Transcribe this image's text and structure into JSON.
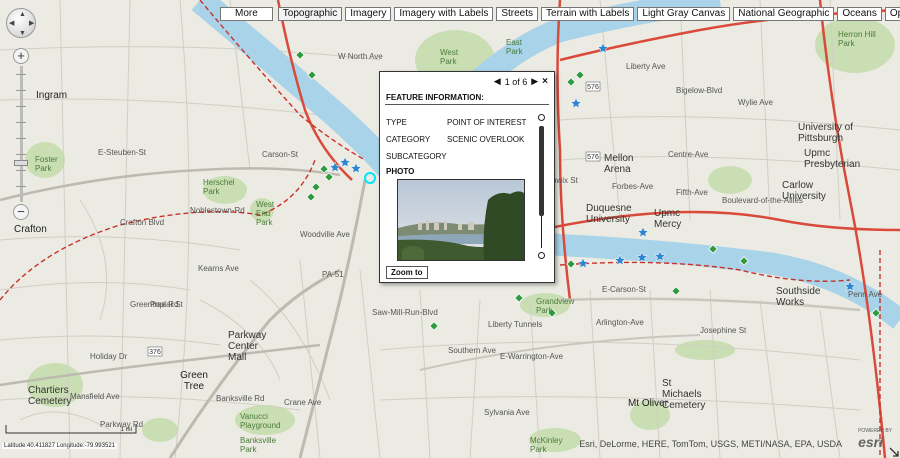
{
  "toolbar": {
    "more_label": "More",
    "basemaps": [
      "Topographic",
      "Imagery",
      "Imagery with Labels",
      "Streets",
      "Terrain with Labels",
      "Light Gray Canvas",
      "National Geographic",
      "Oceans",
      "OpenStreetMap"
    ],
    "active_basemap": "Topographic"
  },
  "navigation": {
    "zoom_in_label": "+",
    "zoom_out_label": "−"
  },
  "popup": {
    "pager": "1 of 6",
    "prev_label": "◀",
    "next_label": "▶",
    "close_label": "×",
    "title": "FEATURE INFORMATION:",
    "fields": [
      {
        "label": "TYPE",
        "value": "POINT OF INTEREST"
      },
      {
        "label": "CATEGORY",
        "value": "SCENIC OVERLOOK"
      },
      {
        "label": "SUBCATEGORY",
        "value": ""
      }
    ],
    "photo_label": "PHOTO",
    "zoom_to_label": "Zoom to"
  },
  "status": {
    "coordinates": "Latitude:40.411827   Longitude:-79.993521",
    "scale_label": "1 mi",
    "attribution": "Esri, DeLorme, HERE, TomTom, USGS, METI/NASA, EPA, USDA",
    "powered_by": "POWERED BY",
    "esri_logo": "esri"
  },
  "map_labels": [
    {
      "text": "Ingram",
      "cls": "town"
    },
    {
      "text": "Crafton",
      "cls": "town"
    },
    {
      "text": "Green Tree",
      "cls": "town"
    },
    {
      "text": "Mt Oliver",
      "cls": "town"
    },
    {
      "text": "West Park",
      "cls": "park"
    },
    {
      "text": "East Park",
      "cls": "park"
    },
    {
      "text": "Herron Hill Park",
      "cls": "park"
    },
    {
      "text": "Foster Park",
      "cls": "park"
    },
    {
      "text": "Herschel Park",
      "cls": "park"
    },
    {
      "text": "West End Park",
      "cls": "park"
    },
    {
      "text": "Mellon Arena",
      "cls": "place"
    },
    {
      "text": "Duquesne University",
      "cls": "place"
    },
    {
      "text": "Upmc Mercy",
      "cls": "place"
    },
    {
      "text": "Carlow University",
      "cls": "place"
    },
    {
      "text": "University of Pittsburgh",
      "cls": "place"
    },
    {
      "text": "Upmc Presbyterian",
      "cls": "place"
    },
    {
      "text": "Southside Works",
      "cls": "place"
    },
    {
      "text": "Grandview Park",
      "cls": "park"
    },
    {
      "text": "Parkway Center Mall",
      "cls": "place"
    },
    {
      "text": "Chartiers Cemetery",
      "cls": "place"
    },
    {
      "text": "Holiday Dr",
      "cls": "road"
    },
    {
      "text": "Vanucci Playground",
      "cls": "park"
    },
    {
      "text": "Banksville Park",
      "cls": "park"
    },
    {
      "text": "St Michaels Cemetery",
      "cls": "place"
    },
    {
      "text": "McKinley Park",
      "cls": "park"
    },
    {
      "text": "Sylvania Ave",
      "cls": "road"
    },
    {
      "text": "W North Ave",
      "cls": "road"
    },
    {
      "text": "E-Steuben-St",
      "cls": "road"
    },
    {
      "text": "Noblestown-Rd",
      "cls": "road"
    },
    {
      "text": "E-Carson-St",
      "cls": "road"
    },
    {
      "text": "Arlington-Ave",
      "cls": "road"
    },
    {
      "text": "E-Warrington-Ave",
      "cls": "road"
    },
    {
      "text": "Liberty Tunnels",
      "cls": "road"
    },
    {
      "text": "Saw-Mill-Run-Blvd",
      "cls": "road"
    },
    {
      "text": "Woodville Ave",
      "cls": "road"
    },
    {
      "text": "Forbes-Ave",
      "cls": "road"
    },
    {
      "text": "Fifth-Ave",
      "cls": "road"
    },
    {
      "text": "Centre-Ave",
      "cls": "road"
    },
    {
      "text": "Bigelow-Blvd",
      "cls": "road"
    },
    {
      "text": "Boulevard-of-the-Allies",
      "cls": "road"
    },
    {
      "text": "Mansfield Ave",
      "cls": "road"
    },
    {
      "text": "Crafton Blvd",
      "cls": "road"
    },
    {
      "text": "Greentree Rd",
      "cls": "road"
    },
    {
      "text": "Carson-St",
      "cls": "road"
    },
    {
      "text": "Kearns Ave",
      "cls": "road"
    },
    {
      "text": "Banksville Rd",
      "cls": "road"
    },
    {
      "text": "Crane Ave",
      "cls": "road"
    },
    {
      "text": "PA-51",
      "cls": "road"
    },
    {
      "text": "Josephine St",
      "cls": "road"
    },
    {
      "text": "Southern Ave",
      "cls": "road"
    },
    {
      "text": "Wylie Ave",
      "cls": "road"
    },
    {
      "text": "Penn Ave",
      "cls": "road"
    },
    {
      "text": "Liberty Ave",
      "cls": "road"
    },
    {
      "text": "Parkway Rd",
      "cls": "road"
    },
    {
      "text": "Poplar St",
      "cls": "road"
    },
    {
      "text": "Stanwix St",
      "cls": "road"
    }
  ],
  "colors": {
    "land": "#ecebe3",
    "river": "#a8d3e8",
    "highway": "#d94a3a",
    "trail": "#c8322a",
    "park_green": "#c9dfb3",
    "marker_green": "#2f9a3e",
    "marker_blue": "#2f86d0"
  }
}
